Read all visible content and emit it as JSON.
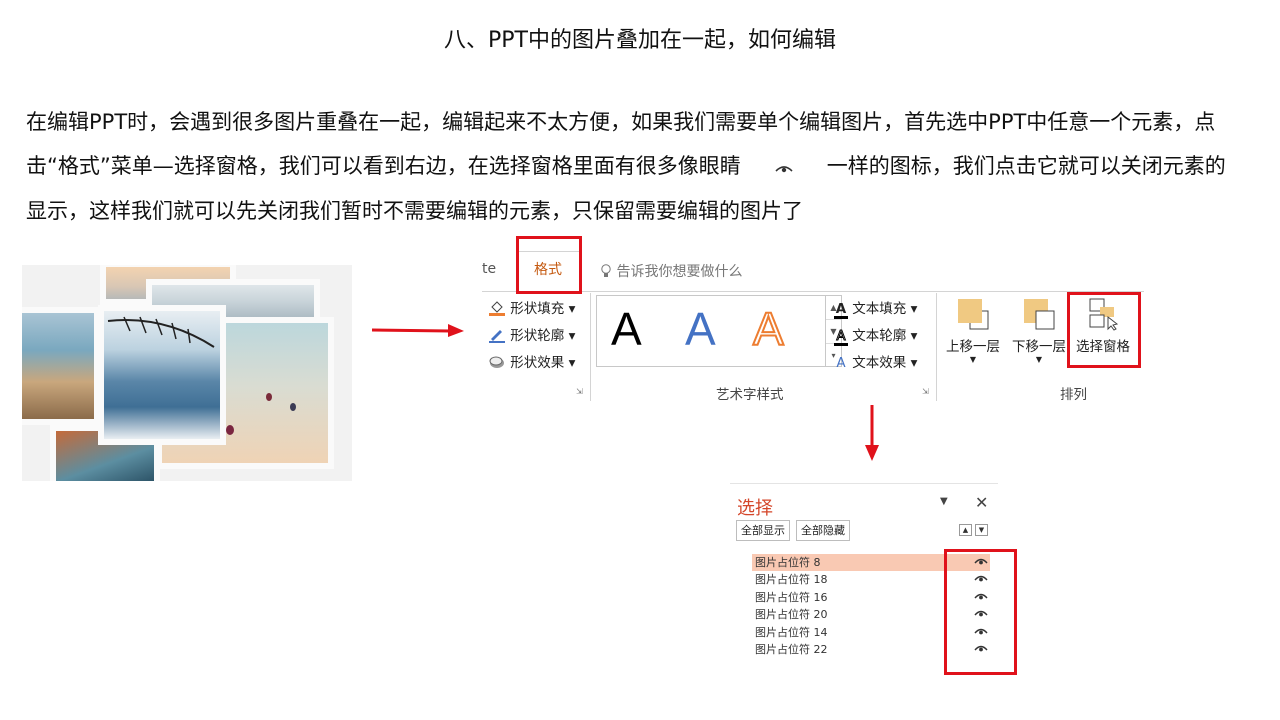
{
  "title": "八、PPT中的图片叠加在一起，如何编辑",
  "paragraph": {
    "part1": "在编辑PPT时，会遇到很多图片重叠在一起，编辑起来不太方便，如果我们需要单个编辑图片，首先选中PPT中任意一个元素，点击“格式”菜单—选择窗格，我们可以看到右边，在选择窗格里面有很多像眼睛",
    "part2": "一样的图标，我们点击它就可以关闭元素的显示，这样我们就可以先关闭我们暂时不需要编辑的元素，只保留需要编辑的图片了"
  },
  "ribbon": {
    "tab_partial": "te",
    "tab_format": "格式",
    "tell_me": "告诉我你想要做什么",
    "shape_fill": "形状填充",
    "shape_outline": "形状轮廓",
    "shape_effects": "形状效果",
    "wordart_sample": "A",
    "text_fill": "文本填充",
    "text_outline": "文本轮廓",
    "text_effects": "文本效果",
    "group_wordart": "艺术字样式",
    "bring_forward": "上移一层",
    "send_backward": "下移一层",
    "selection_pane": "选择窗格",
    "group_arrange": "排列",
    "colors": {
      "accent_red": "#e0121b",
      "format_tab": "#c55a11",
      "wordart_blue": "#4472c4",
      "wordart_orange": "#ed7d31"
    }
  },
  "pane": {
    "title": "选择",
    "show_all": "全部显示",
    "hide_all": "全部隐藏",
    "items": [
      {
        "label": "图片占位符 8",
        "selected": true
      },
      {
        "label": "图片占位符 18",
        "selected": false
      },
      {
        "label": "图片占位符 16",
        "selected": false
      },
      {
        "label": "图片占位符 20",
        "selected": false
      },
      {
        "label": "图片占位符 14",
        "selected": false
      },
      {
        "label": "图片占位符 22",
        "selected": false
      }
    ]
  }
}
